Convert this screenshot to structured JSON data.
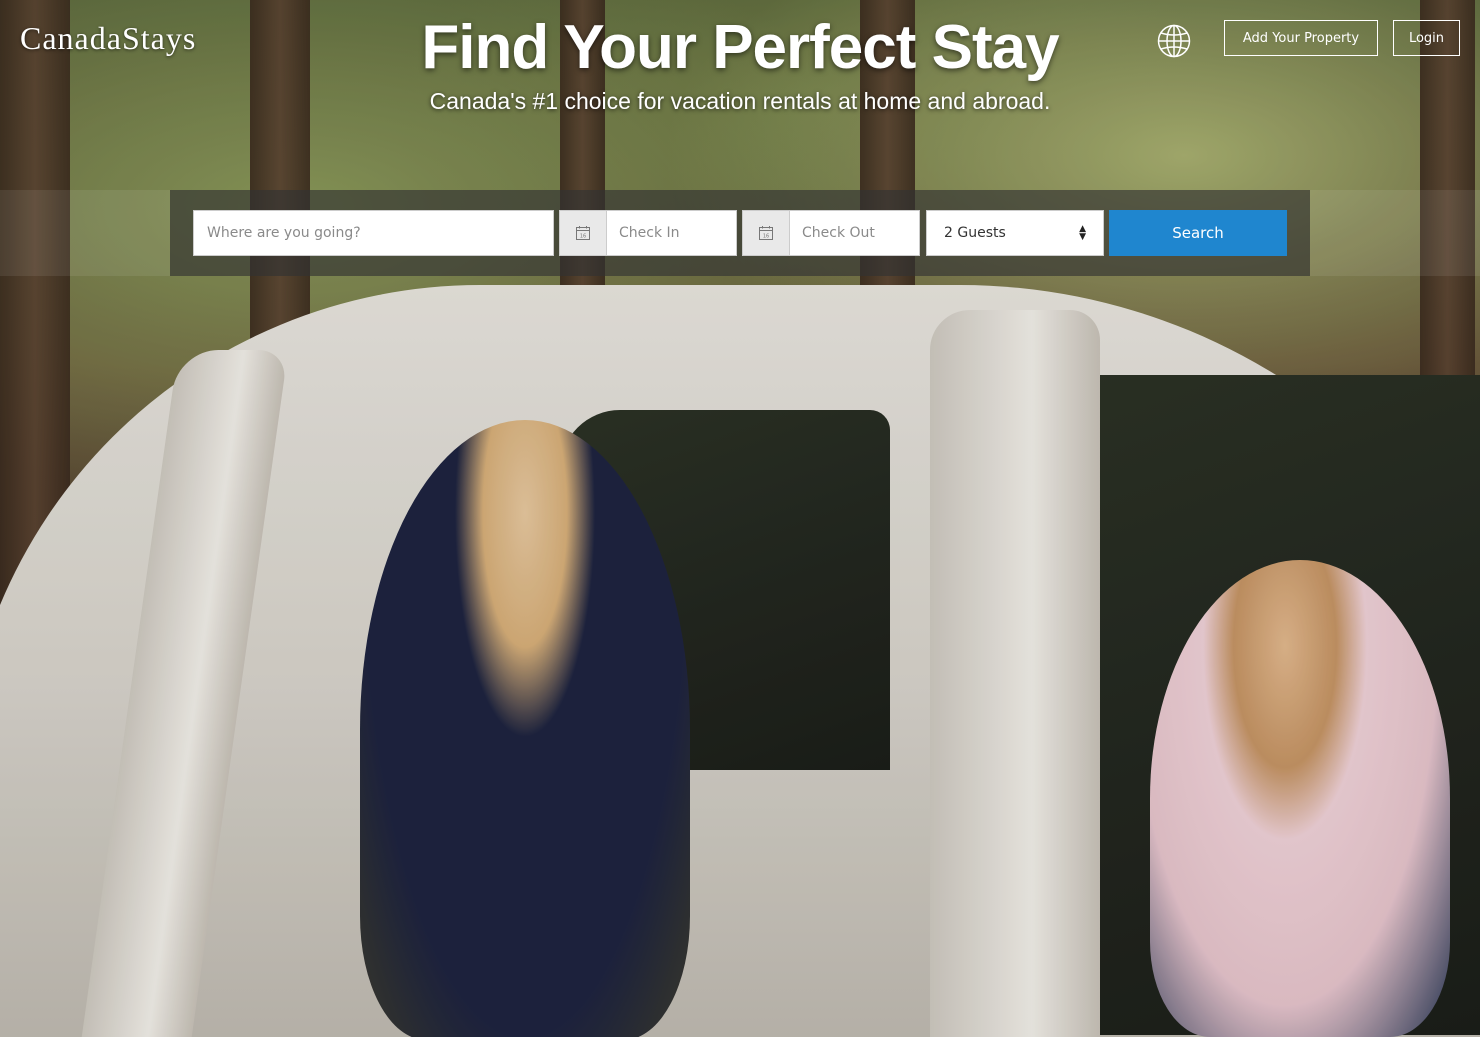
{
  "header": {
    "logo_text": "CanadaStays",
    "add_property_label": "Add Your Property",
    "login_label": "Login",
    "language_icon": "globe-icon"
  },
  "hero": {
    "title": "Find Your Perfect Stay",
    "subtitle": "Canada's #1 choice for vacation rentals at home and abroad."
  },
  "search": {
    "destination_placeholder": "Where are you going?",
    "check_in_placeholder": "Check In",
    "check_out_placeholder": "Check Out",
    "calendar_icon": "calendar-icon",
    "guests_selected": "2 Guests",
    "search_label": "Search"
  },
  "colors": {
    "search_button": "#1f86cf",
    "text_on_hero": "#ffffff"
  }
}
